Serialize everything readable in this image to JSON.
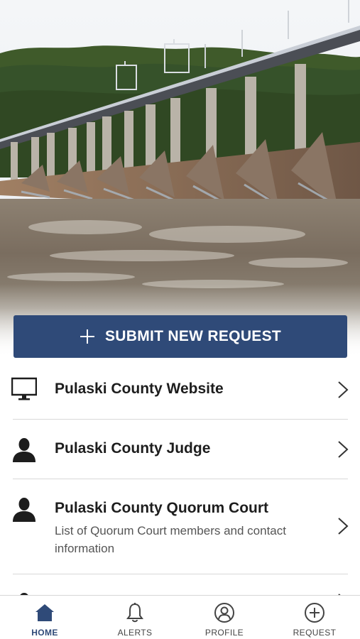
{
  "submit": {
    "label": "SUBMIT NEW REQUEST"
  },
  "list": [
    {
      "title": "Pulaski County Website",
      "subtitle": "",
      "icon": "monitor-icon"
    },
    {
      "title": "Pulaski County Judge",
      "subtitle": "",
      "icon": "person-icon"
    },
    {
      "title": "Pulaski County Quorum Court",
      "subtitle": "List of Quorum Court members and contact information",
      "icon": "person-icon"
    }
  ],
  "tabs": [
    {
      "label": "HOME",
      "icon": "home-icon",
      "active": true
    },
    {
      "label": "ALERTS",
      "icon": "bell-icon",
      "active": false
    },
    {
      "label": "PROFILE",
      "icon": "profile-icon",
      "active": false
    },
    {
      "label": "REQUEST",
      "icon": "plus-circle-icon",
      "active": false
    }
  ],
  "colors": {
    "accent": "#2f4a78",
    "divider": "#d8d8d8",
    "text": "#1d1d1d",
    "muted": "#555555"
  }
}
